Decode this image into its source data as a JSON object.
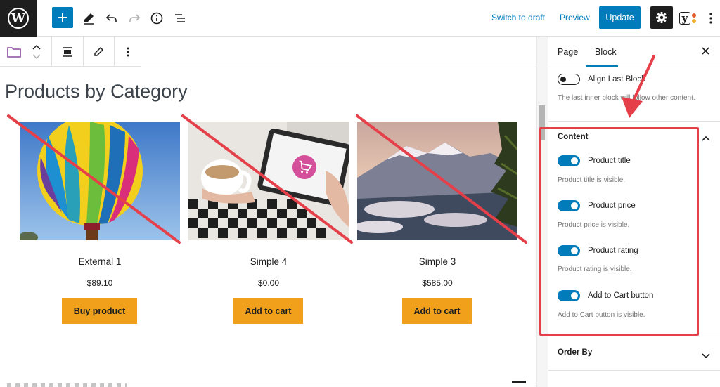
{
  "topbar": {
    "logo_letter": "W",
    "switch_to_draft": "Switch to draft",
    "preview": "Preview",
    "update": "Update",
    "yoast_letter": "y"
  },
  "editor": {
    "title": "Products by Category",
    "products": [
      {
        "name": "External 1",
        "price": "$89.10",
        "button": "Buy product"
      },
      {
        "name": "Simple 4",
        "price": "$0.00",
        "button": "Add to cart"
      },
      {
        "name": "Simple 3",
        "price": "$585.00",
        "button": "Add to cart"
      }
    ]
  },
  "sidebar": {
    "tabs": [
      "Page",
      "Block"
    ],
    "active_tab": "Block",
    "align_last_block": {
      "label": "Align Last Block",
      "help": "The last inner block will follow other content.",
      "enabled": false
    },
    "content": {
      "title": "Content",
      "toggles": [
        {
          "label": "Product title",
          "help": "Product title is visible.",
          "enabled": true
        },
        {
          "label": "Product price",
          "help": "Product price is visible.",
          "enabled": true
        },
        {
          "label": "Product rating",
          "help": "Product rating is visible.",
          "enabled": true
        },
        {
          "label": "Add to Cart button",
          "help": "Add to Cart button is visible.",
          "enabled": true
        }
      ]
    },
    "order_by": {
      "title": "Order By"
    }
  },
  "colors": {
    "accent": "#007cba",
    "cart_button": "#f0a01a",
    "annotation_red": "#e5404a"
  }
}
